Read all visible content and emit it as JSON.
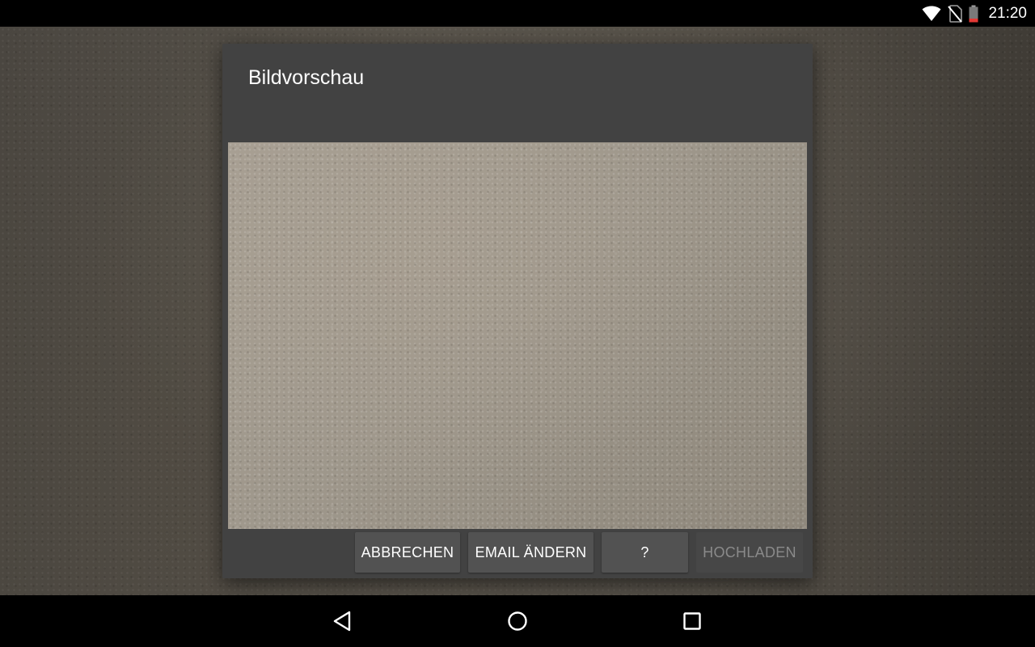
{
  "status_bar": {
    "time": "21:20",
    "icons": [
      "wifi-icon",
      "no-sim-icon",
      "battery-low-icon"
    ],
    "battery_color": "#e53935"
  },
  "dialog": {
    "title": "Bildvorschau",
    "buttons": {
      "cancel": "ABBRECHEN",
      "change_email": "EMAIL ÄNDERN",
      "help": "?",
      "upload": "HOCHLADEN"
    },
    "upload_enabled": false
  },
  "nav_bar": {
    "icons": [
      "back-icon",
      "home-icon",
      "recents-icon"
    ]
  },
  "colors": {
    "dialog_bg": "#424242",
    "button_bg": "#525252",
    "disabled_text": "#8a8a8a"
  }
}
